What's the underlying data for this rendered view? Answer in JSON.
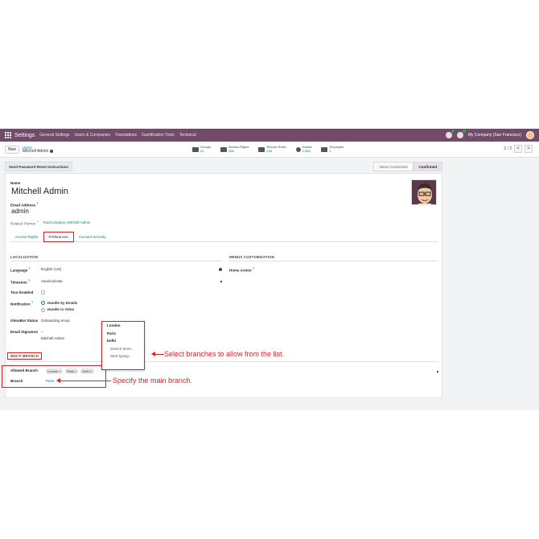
{
  "navbar": {
    "brand": "Settings",
    "menu": [
      "General Settings",
      "Users & Companies",
      "Translations",
      "Gamification Tools",
      "Technical"
    ],
    "company": "My Company (San Francisco)",
    "icons": [
      "apps-grid-icon",
      "chat-icon",
      "activity-clock-icon",
      "user-avatar-icon"
    ]
  },
  "control": {
    "new_label": "New",
    "breadcrumb_parent": "Users",
    "breadcrumb_current": "Mitchell Admin",
    "stats": [
      {
        "label": "Groups",
        "value": "41"
      },
      {
        "label": "Access Rights",
        "value": "386"
      },
      {
        "label": "Record Rules",
        "value": "133"
      },
      {
        "label": "Karma",
        "value": "2,506"
      },
      {
        "label": "Employee",
        "value": "1"
      }
    ],
    "pager": "2 / 2",
    "pager_prev": "<",
    "pager_next": ">"
  },
  "statusbar": {
    "reset_label": "Send Password Reset Instructions",
    "states": [
      "Never Connected",
      "Confirmed"
    ],
    "active_state": "Confirmed"
  },
  "form": {
    "name_label": "Name",
    "name_value": "Mitchell Admin",
    "email_label": "Email Address",
    "email_value": "admin",
    "partner_label": "Related Partner",
    "partner_value": "YourCompany, Mitchell Admin",
    "help_mark": "?",
    "tabs": [
      "Access Rights",
      "Preferences",
      "Account Security"
    ],
    "active_tab": "Preferences"
  },
  "localization": {
    "title": "LOCALIZATION",
    "language_label": "Language",
    "language_value": "English (US)",
    "timezone_label": "Timezone",
    "timezone_value": "Asia/Calcutta",
    "tour_label": "Tour Enabled",
    "notification_label": "Notification",
    "notification_options": [
      "Handle by Emails",
      "Handle in Odoo"
    ],
    "odoobot_label": "OdooBot Status",
    "odoobot_value": "Onboarding emoji",
    "signature_label": "Email Signature",
    "signature_value_1": "--",
    "signature_value_2": "Mitchell Admin"
  },
  "menus": {
    "title": "MENUS CUSTOMIZATION",
    "home_action_label": "Home Action"
  },
  "multi_branch": {
    "title": "MULTI BRANCH",
    "allowed_label": "Allowed Branch",
    "allowed_tags": [
      "London",
      "Paris",
      "Delhi"
    ],
    "tag_remove": "×",
    "branch_label": "Branch",
    "branch_value": "Paris"
  },
  "dropdown": {
    "items": [
      "London",
      "Paris",
      "Delhi"
    ],
    "search_more": "Search More...",
    "start_typing": "Start typing..."
  },
  "annotations": {
    "select_branches": "Select branches to allow from the list.",
    "main_branch": "Specify the main branch."
  },
  "colors": {
    "navbar": "#714b67",
    "link": "#017e84",
    "highlight": "#e02020"
  }
}
